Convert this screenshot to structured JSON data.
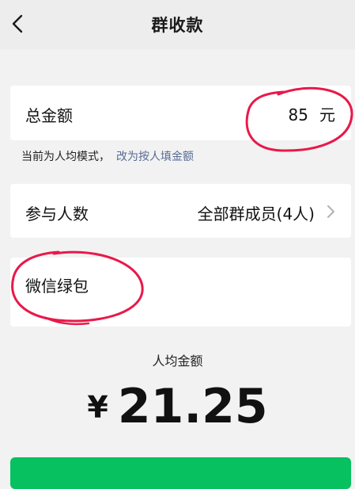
{
  "header": {
    "title": "群收款",
    "back_icon": "chevron-left-icon"
  },
  "total_amount": {
    "label": "总金额",
    "value": "85",
    "unit": "元"
  },
  "mode": {
    "current_text": "当前为人均模式，",
    "switch_link": "改为按人填金额"
  },
  "participants": {
    "label": "参与人数",
    "value": "全部群成员(4人)",
    "icon": "chevron-right-icon"
  },
  "blessing": {
    "text": "微信绿包"
  },
  "average": {
    "label": "人均金额",
    "currency": "¥",
    "value": "21.25"
  },
  "colors": {
    "accent_green": "#07c160",
    "link_blue": "#576b95",
    "annotation_red": "#e8194a"
  }
}
